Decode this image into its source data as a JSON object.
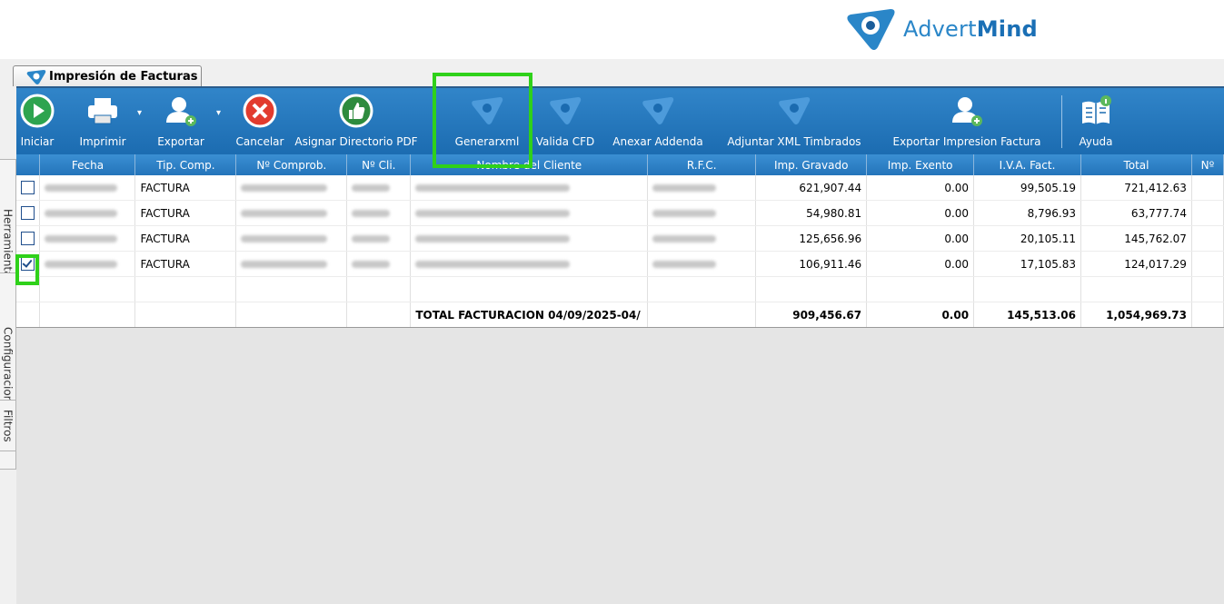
{
  "logo": {
    "text_plain": "Advert",
    "text_bold": "Mind"
  },
  "tab": {
    "title": "Impresión de Facturas"
  },
  "sidebar": {
    "herramientas": "Herramientas",
    "configuraciones": "Configuraciones",
    "filtros": "Filtros"
  },
  "toolbar": {
    "iniciar": "Iniciar",
    "imprimir": "Imprimir",
    "exportar": "Exportar",
    "cancelar": "Cancelar",
    "asignar": "Asignar Directorio PDF",
    "generarxml": "Generarxml",
    "valida": "Valida CFD",
    "anexar": "Anexar Addenda",
    "adjuntar": "Adjuntar XML Timbrados",
    "exportar_impresion": "Exportar Impresion Factura",
    "ayuda": "Ayuda"
  },
  "colors": {
    "toolbar": "#1f72b8",
    "highlight": "#2fd11a",
    "brand": "#2a86c8"
  },
  "table": {
    "headers": [
      "Fecha",
      "Tip. Comp.",
      "Nº Comprob.",
      "Nº Cli.",
      "Nombre del Cliente",
      "R.F.C.",
      "Imp. Gravado",
      "Imp. Exento",
      "I.V.A. Fact.",
      "Total",
      "Nº"
    ],
    "rows": [
      {
        "tipo": "FACTURA",
        "gravado": "621,907.44",
        "exento": "0.00",
        "iva": "99,505.19",
        "total": "721,412.63"
      },
      {
        "tipo": "FACTURA",
        "gravado": "54,980.81",
        "exento": "0.00",
        "iva": "8,796.93",
        "total": "63,777.74"
      },
      {
        "tipo": "FACTURA",
        "gravado": "125,656.96",
        "exento": "0.00",
        "iva": "20,105.11",
        "total": "145,762.07"
      },
      {
        "tipo": "FACTURA",
        "gravado": "106,911.46",
        "exento": "0.00",
        "iva": "17,105.83",
        "total": "124,017.29"
      }
    ],
    "total": {
      "label": "TOTAL FACTURACION 04/09/2025-04/",
      "gravado": "909,456.67",
      "exento": "0.00",
      "iva": "145,513.06",
      "total": "1,054,969.73"
    }
  }
}
